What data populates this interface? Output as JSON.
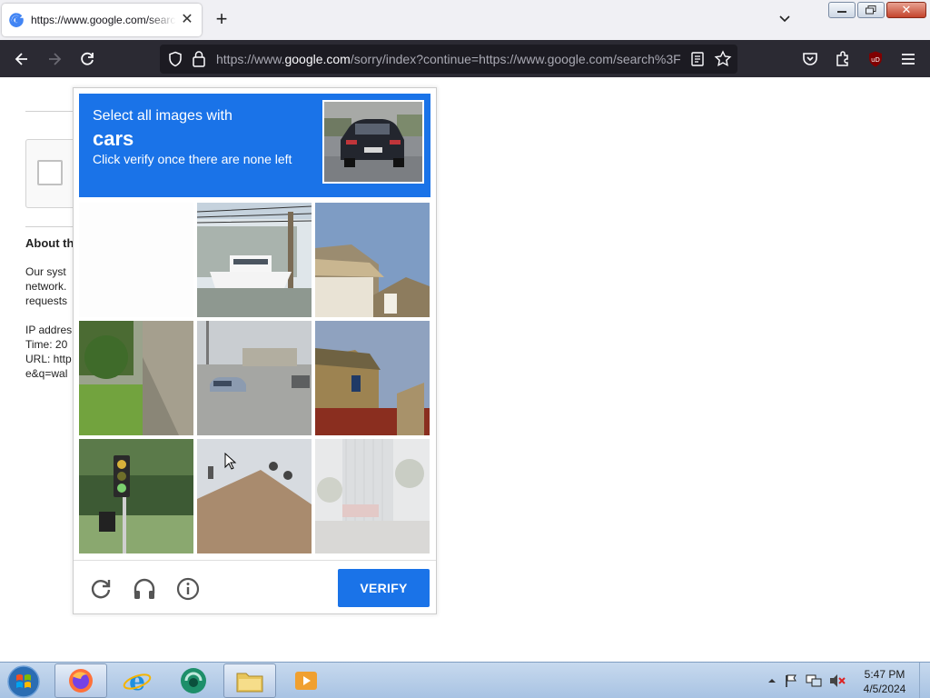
{
  "browser": {
    "tab": {
      "title": "https://www.google.com/search?q=wal",
      "favicon": "google-g-icon"
    },
    "url": {
      "prefix": "https://www.",
      "domain": "google.com",
      "rest": "/sorry/index?continue=https://www.google.com/search%3F"
    },
    "accent": "#2b2a33"
  },
  "background_page": {
    "heading": "About th",
    "para1": [
      "Our syst",
      "network.",
      "requests"
    ],
    "para2": [
      "IP addres",
      "Time: 20",
      "URL: http",
      "e&q=wal"
    ]
  },
  "captcha": {
    "line1": "Select all images with",
    "target": "cars",
    "line3": "Click verify once there are none left",
    "tiles": [
      "blank-loading-tile",
      "boat-in-lot-tile",
      "house-roof-tile",
      "hillside-plants-tile",
      "car-on-road-tile",
      "house-facade-tile",
      "traffic-light-tile",
      "roof-tile",
      "building-palms-tile"
    ],
    "footer": {
      "reload_icon": "reload-icon",
      "audio_icon": "headphones-icon",
      "info_icon": "info-icon",
      "verify_label": "VERIFY"
    },
    "colors": {
      "header": "#1a73e8",
      "verify": "#1a73e8"
    }
  },
  "taskbar": {
    "apps": [
      "firefox-icon",
      "internet-explorer-icon",
      "media-app-icon",
      "file-explorer-icon",
      "media-player-icon"
    ],
    "time": "5:47 PM",
    "date": "4/5/2024"
  }
}
